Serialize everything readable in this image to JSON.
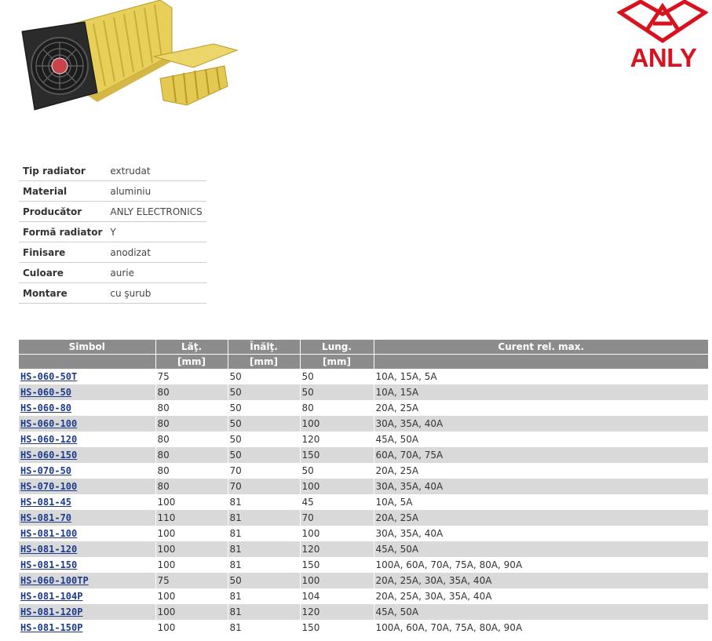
{
  "brand": {
    "name": "ANLY",
    "color": "#d8121f"
  },
  "specs": [
    {
      "label": "Tip radiator",
      "value": "extrudat"
    },
    {
      "label": "Material",
      "value": "aluminiu"
    },
    {
      "label": "Producător",
      "value": "ANLY ELECTRONICS"
    },
    {
      "label": "Formă radiator",
      "value": "Y"
    },
    {
      "label": "Finisare",
      "value": "anodizat"
    },
    {
      "label": "Culoare",
      "value": "aurie"
    },
    {
      "label": "Montare",
      "value": "cu şurub"
    }
  ],
  "products": {
    "header": {
      "symbol": "Simbol",
      "width": "Lăţ.",
      "height": "Înălţ.",
      "length": "Lung.",
      "current": "Curent rel. max.",
      "unit_width": "[mm]",
      "unit_height": "[mm]",
      "unit_length": "[mm]"
    },
    "rows": [
      {
        "symbol": "HS-060-50T",
        "width": "75",
        "height": "50",
        "length": "50",
        "current": "10A, 15A, 5A"
      },
      {
        "symbol": "HS-060-50",
        "width": "80",
        "height": "50",
        "length": "50",
        "current": "10A, 15A"
      },
      {
        "symbol": "HS-060-80",
        "width": "80",
        "height": "50",
        "length": "80",
        "current": "20A, 25A"
      },
      {
        "symbol": "HS-060-100",
        "width": "80",
        "height": "50",
        "length": "100",
        "current": "30A, 35A, 40A"
      },
      {
        "symbol": "HS-060-120",
        "width": "80",
        "height": "50",
        "length": "120",
        "current": "45A, 50A"
      },
      {
        "symbol": "HS-060-150",
        "width": "80",
        "height": "50",
        "length": "150",
        "current": "60A, 70A, 75A"
      },
      {
        "symbol": "HS-070-50",
        "width": "80",
        "height": "70",
        "length": "50",
        "current": "20A, 25A"
      },
      {
        "symbol": "HS-070-100",
        "width": "80",
        "height": "70",
        "length": "100",
        "current": "30A, 35A, 40A"
      },
      {
        "symbol": "HS-081-45",
        "width": "100",
        "height": "81",
        "length": "45",
        "current": "10A, 5A"
      },
      {
        "symbol": "HS-081-70",
        "width": "110",
        "height": "81",
        "length": "70",
        "current": "20A, 25A"
      },
      {
        "symbol": "HS-081-100",
        "width": "100",
        "height": "81",
        "length": "100",
        "current": "30A, 35A, 40A"
      },
      {
        "symbol": "HS-081-120",
        "width": "100",
        "height": "81",
        "length": "120",
        "current": "45A, 50A"
      },
      {
        "symbol": "HS-081-150",
        "width": "100",
        "height": "81",
        "length": "150",
        "current": "100A, 60A, 70A, 75A, 80A, 90A"
      },
      {
        "symbol": "HS-060-100TP",
        "width": "75",
        "height": "50",
        "length": "100",
        "current": "20A, 25A, 30A, 35A, 40A"
      },
      {
        "symbol": "HS-081-104P",
        "width": "100",
        "height": "81",
        "length": "104",
        "current": "20A, 25A, 30A, 35A, 40A"
      },
      {
        "symbol": "HS-081-120P",
        "width": "100",
        "height": "81",
        "length": "120",
        "current": "45A, 50A"
      },
      {
        "symbol": "HS-081-150P",
        "width": "100",
        "height": "81",
        "length": "150",
        "current": "100A, 60A, 70A, 75A, 80A, 90A"
      }
    ]
  }
}
